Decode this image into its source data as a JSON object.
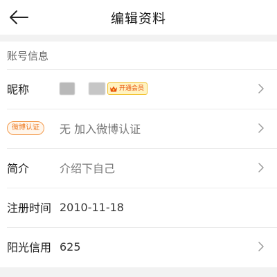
{
  "header": {
    "title": "编辑资料",
    "back_icon": "arrow-left-icon"
  },
  "section": {
    "title": "账号信息"
  },
  "rows": {
    "nickname": {
      "label": "昵称",
      "vip_badge": "开通会员",
      "vip_icon": "crown-icon"
    },
    "weibo": {
      "badge": "微博认证",
      "value": "无 加入微博认证"
    },
    "intro": {
      "label": "简介",
      "value": "介绍下自己"
    },
    "register": {
      "label": "注册时间",
      "value": "2010-11-18"
    },
    "credit": {
      "label": "阳光信用",
      "value": "625"
    }
  },
  "icons": {
    "chevron": "chevron-right-icon"
  },
  "colors": {
    "accent": "#ee7a22",
    "badge_bg": "#fff3c0",
    "divider": "#ebebeb",
    "page_gap": "#f2f2f2"
  }
}
